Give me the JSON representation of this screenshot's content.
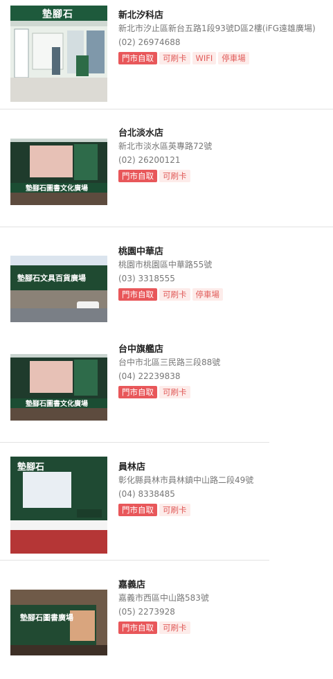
{
  "stores": [
    {
      "name": "新北汐科店",
      "address": "新北市汐止區新台五路1段93號D區2樓(iFG遠雄廣場)",
      "phone": "(02) 26974688",
      "tags": [
        {
          "label": "門市自取",
          "style": "solid"
        },
        {
          "label": "可刷卡",
          "style": "light"
        },
        {
          "label": "WIFI",
          "style": "light"
        },
        {
          "label": "停車場",
          "style": "light"
        }
      ],
      "photo_caption": "墊腳石"
    },
    {
      "name": "台北淡水店",
      "address": "新北市淡水區英專路72號",
      "phone": "(02) 26200121",
      "tags": [
        {
          "label": "門市自取",
          "style": "solid"
        },
        {
          "label": "可刷卡",
          "style": "light"
        }
      ],
      "photo_caption": "墊腳石圖書文化廣場"
    },
    {
      "name": "桃園中華店",
      "address": "桃園市桃園區中華路55號",
      "phone": "(03) 3318555",
      "tags": [
        {
          "label": "門市自取",
          "style": "solid"
        },
        {
          "label": "可刷卡",
          "style": "light"
        },
        {
          "label": "停車場",
          "style": "light"
        }
      ],
      "photo_caption": "墊腳石文具百貨廣場"
    },
    {
      "name": "台中旗艦店",
      "address": "台中市北區三民路三段88號",
      "phone": "(04) 22239838",
      "tags": [
        {
          "label": "門市自取",
          "style": "solid"
        },
        {
          "label": "可刷卡",
          "style": "light"
        }
      ],
      "photo_caption": "墊腳石圖書文化廣場"
    },
    {
      "name": "員林店",
      "address": "彰化縣員林市員林鎮中山路二段49號",
      "phone": "(04) 8338485",
      "tags": [
        {
          "label": "門市自取",
          "style": "solid"
        },
        {
          "label": "可刷卡",
          "style": "light"
        }
      ],
      "photo_caption": "墊腳石"
    },
    {
      "name": "嘉義店",
      "address": "嘉義市西區中山路583號",
      "phone": "(05) 2273928",
      "tags": [
        {
          "label": "門市自取",
          "style": "solid"
        },
        {
          "label": "可刷卡",
          "style": "light"
        }
      ],
      "photo_caption": "墊腳石圖書廣場"
    }
  ]
}
